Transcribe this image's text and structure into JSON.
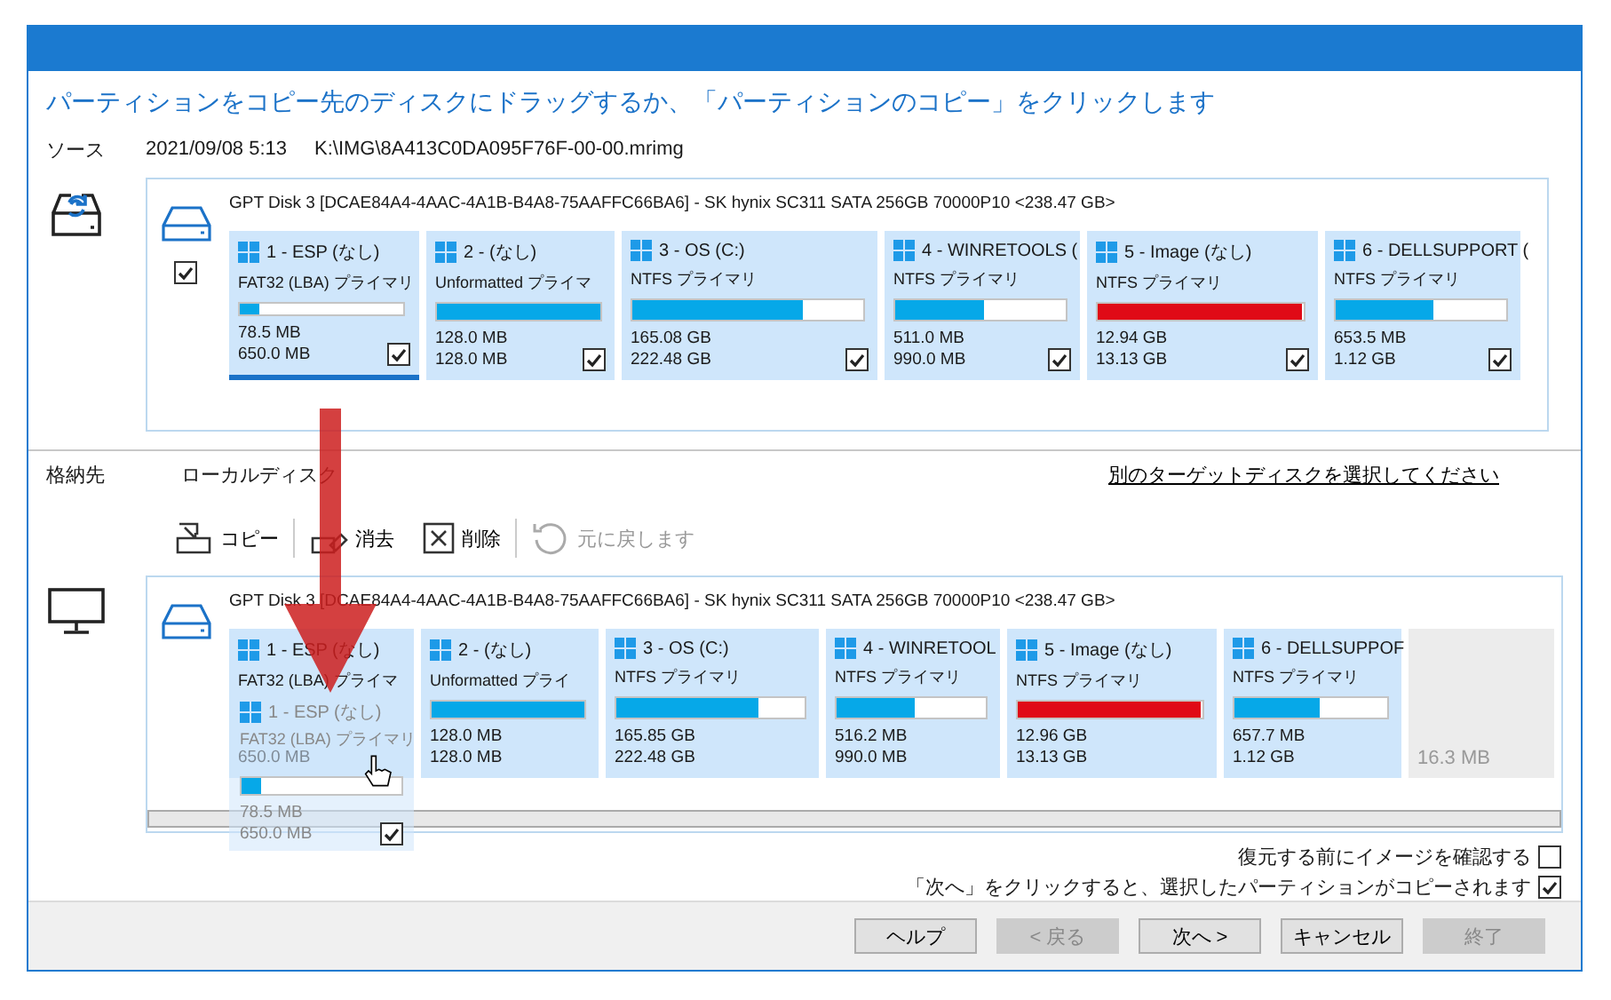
{
  "heading": "パーティションをコピー先のディスクにドラッグするか、「パーティションのコピー」をクリックします",
  "source": {
    "label": "ソース",
    "date": "2021/09/08 5:13",
    "path": "K:\\IMG\\8A413C0DA095F76F-00-00.mrimg",
    "disk": {
      "title": "GPT Disk 3 [DCAE84A4-4AAC-4A1B-B4A8-75AAFFC66BA6] - SK hynix SC311 SATA 256GB 70000P10  <238.47 GB>",
      "checked": true,
      "partitions": [
        {
          "title": "1 - ESP (なし)",
          "type": "FAT32 (LBA) プライマリ",
          "used": "78.5 MB",
          "total": "650.0 MB",
          "level": 0.12,
          "color": "#06a8e8",
          "checked": true,
          "selected": true
        },
        {
          "title": "2 -  (なし)",
          "type": "Unformatted プライマ",
          "used": "128.0 MB",
          "total": "128.0 MB",
          "level": 1,
          "color": "#06a8e8",
          "checked": true,
          "selected": false
        },
        {
          "title": "3 - OS (C:)",
          "type": "NTFS プライマリ",
          "used": "165.08 GB",
          "total": "222.48 GB",
          "level": 0.74,
          "color": "#06a8e8",
          "checked": true,
          "selected": false
        },
        {
          "title": "4 - WINRETOOLS (",
          "type": "NTFS プライマリ",
          "used": "511.0 MB",
          "total": "990.0 MB",
          "level": 0.52,
          "color": "#06a8e8",
          "checked": true,
          "selected": false
        },
        {
          "title": "5 - Image (なし)",
          "type": "NTFS プライマリ",
          "used": "12.94 GB",
          "total": "13.13 GB",
          "level": 0.99,
          "color": "#e00a16",
          "checked": true,
          "selected": false
        },
        {
          "title": "6 - DELLSUPPORT (",
          "type": "NTFS プライマリ",
          "used": "653.5 MB",
          "total": "1.12 GB",
          "level": 0.57,
          "color": "#06a8e8",
          "checked": true,
          "selected": false
        }
      ]
    }
  },
  "destination": {
    "label": "格納先",
    "name": "ローカルディスク",
    "link": "別のターゲットディスクを選択してください",
    "toolbar": [
      {
        "kind": "copy",
        "label": "コピー",
        "disabled": false
      },
      {
        "kind": "erase",
        "label": "消去",
        "disabled": false
      },
      {
        "kind": "delete",
        "label": "削除",
        "disabled": false
      },
      {
        "kind": "undo",
        "label": "元に戻します",
        "disabled": true
      }
    ],
    "disk": {
      "title": "GPT Disk 3 [DCAE84A4-4AAC-4A1B-B4A8-75AAFFC66BA6] - SK hynix SC311 SATA 256GB 70000P10  <238.47 GB>",
      "partitions": [
        {
          "kind": "partition",
          "title": "1 - ESP (なし)",
          "type": "FAT32 (LBA) プライマ",
          "total": "650.0 MB"
        },
        {
          "kind": "partition",
          "title": "2 -  (なし)",
          "type": "Unformatted プライ",
          "used": "128.0 MB",
          "total": "128.0 MB",
          "level": 1,
          "color": "#06a8e8"
        },
        {
          "kind": "partition",
          "title": "3 - OS (C:)",
          "type": "NTFS プライマリ",
          "used": "165.85 GB",
          "total": "222.48 GB",
          "level": 0.75,
          "color": "#06a8e8"
        },
        {
          "kind": "partition",
          "title": "4 - WINRETOOL",
          "type": "NTFS プライマリ",
          "used": "516.2 MB",
          "total": "990.0 MB",
          "level": 0.52,
          "color": "#06a8e8"
        },
        {
          "kind": "partition",
          "title": "5 - Image (なし)",
          "type": "NTFS プライマリ",
          "used": "12.96 GB",
          "total": "13.13 GB",
          "level": 0.99,
          "color": "#e00a16"
        },
        {
          "kind": "partition",
          "title": "6 - DELLSUPPOF",
          "type": "NTFS プライマリ",
          "used": "657.7 MB",
          "total": "1.12 GB",
          "level": 0.56,
          "color": "#06a8e8"
        },
        {
          "kind": "unallocated",
          "total": "16.3 MB"
        }
      ]
    },
    "dragged": {
      "title": "1 - ESP (なし)",
      "type": "FAT32 (LBA) プライマリ",
      "used": "78.5 MB",
      "total": "650.0 MB",
      "level": 0.12,
      "color": "#06a8e8",
      "checked": true
    }
  },
  "options": [
    {
      "label": "復元する前にイメージを確認する",
      "checked": false
    },
    {
      "label": "「次へ」をクリックすると、選択したパーティションがコピーされます",
      "checked": true
    }
  ],
  "buttons": [
    {
      "label": "ヘルプ",
      "disabled": false
    },
    {
      "label": "< 戻る",
      "disabled": true
    },
    {
      "label": "次へ >",
      "disabled": false
    },
    {
      "label": "キャンセル",
      "disabled": false
    },
    {
      "label": "終了",
      "disabled": true
    }
  ]
}
